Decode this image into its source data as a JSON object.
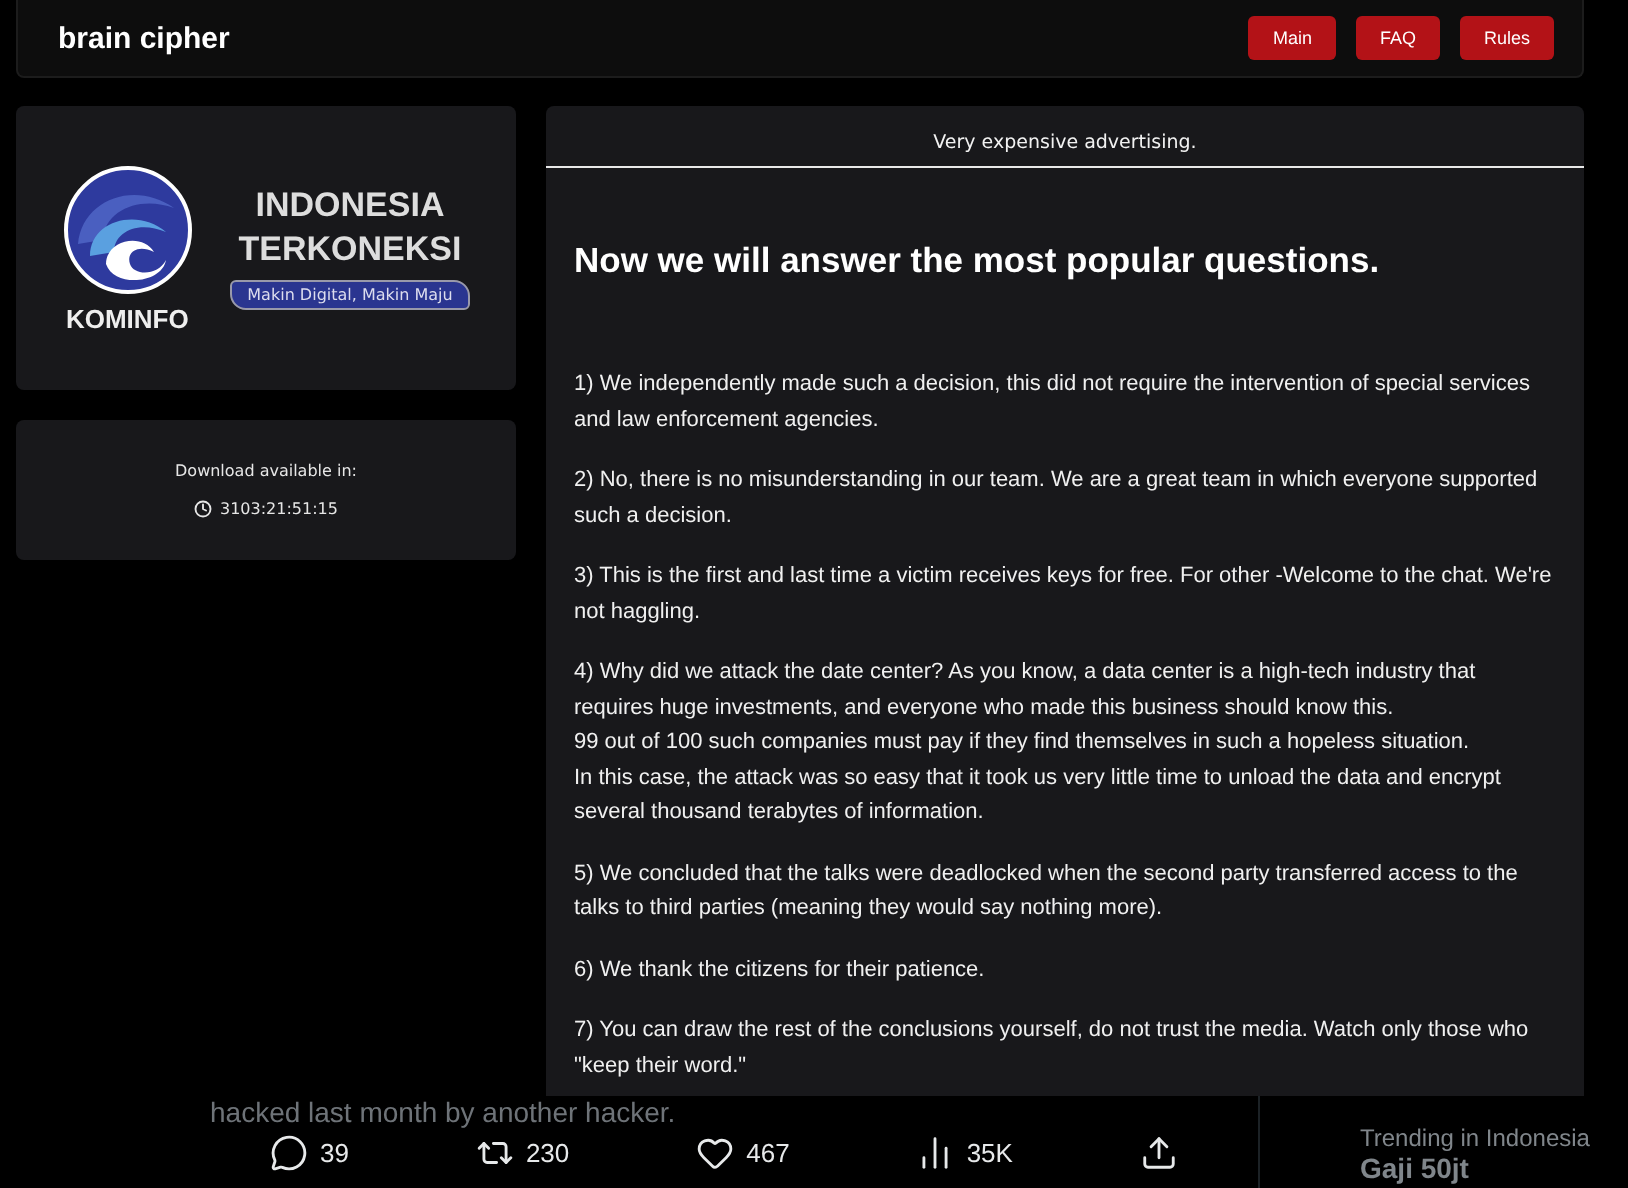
{
  "header": {
    "title": "brain cipher",
    "nav": [
      {
        "label": "Main"
      },
      {
        "label": "FAQ"
      },
      {
        "label": "Rules"
      }
    ]
  },
  "banner": {
    "logo_name": "KOMINFO",
    "headline_1": "INDONESIA",
    "headline_2": "TERKONEKSI",
    "slogan": "Makin Digital, Makin Maju"
  },
  "countdown": {
    "label": "Download available in:",
    "time": "3103:21:51:15"
  },
  "notice": {
    "caption": "Very expensive advertising.",
    "heading": "Now we will answer the most popular questions.",
    "paragraphs": [
      "1) We independently made such a decision, this did not require the intervention of special services and law enforcement agencies.",
      "2) No, there is no misunderstanding in our team. We are a great team in which everyone supported such a decision.",
      "3) This is the first and last time a victim receives keys for free. For other -Welcome to the chat. We're not haggling.",
      "4) Why did we attack the date center? As you know, a data center is a high-tech industry that requires huge investments, and everyone who made this business should know this.\n99 out of 100 such companies must pay if they find themselves in such a hopeless situation.\nIn this case, the attack was so easy that it took us very little time to unload the data and encrypt several thousand terabytes of information.",
      "5) We concluded that the talks were deadlocked when the second party transferred access to the talks to third parties (meaning they would say nothing more).",
      "6) We thank the citizens for their patience.",
      "7) You can draw the rest of the conclusions yourself, do not trust the media. Watch only those who \"keep their word.\""
    ]
  },
  "tweet": {
    "text": "hacked last month by another hacker.",
    "actions": [
      {
        "kind": "reply",
        "count": "39"
      },
      {
        "kind": "repost",
        "count": "230"
      },
      {
        "kind": "like",
        "count": "467"
      },
      {
        "kind": "views",
        "count": "35K"
      },
      {
        "kind": "share"
      }
    ],
    "sidebar": {
      "trending_label": "Trending in Indonesia",
      "topic": "Gaji 50jt"
    }
  }
}
